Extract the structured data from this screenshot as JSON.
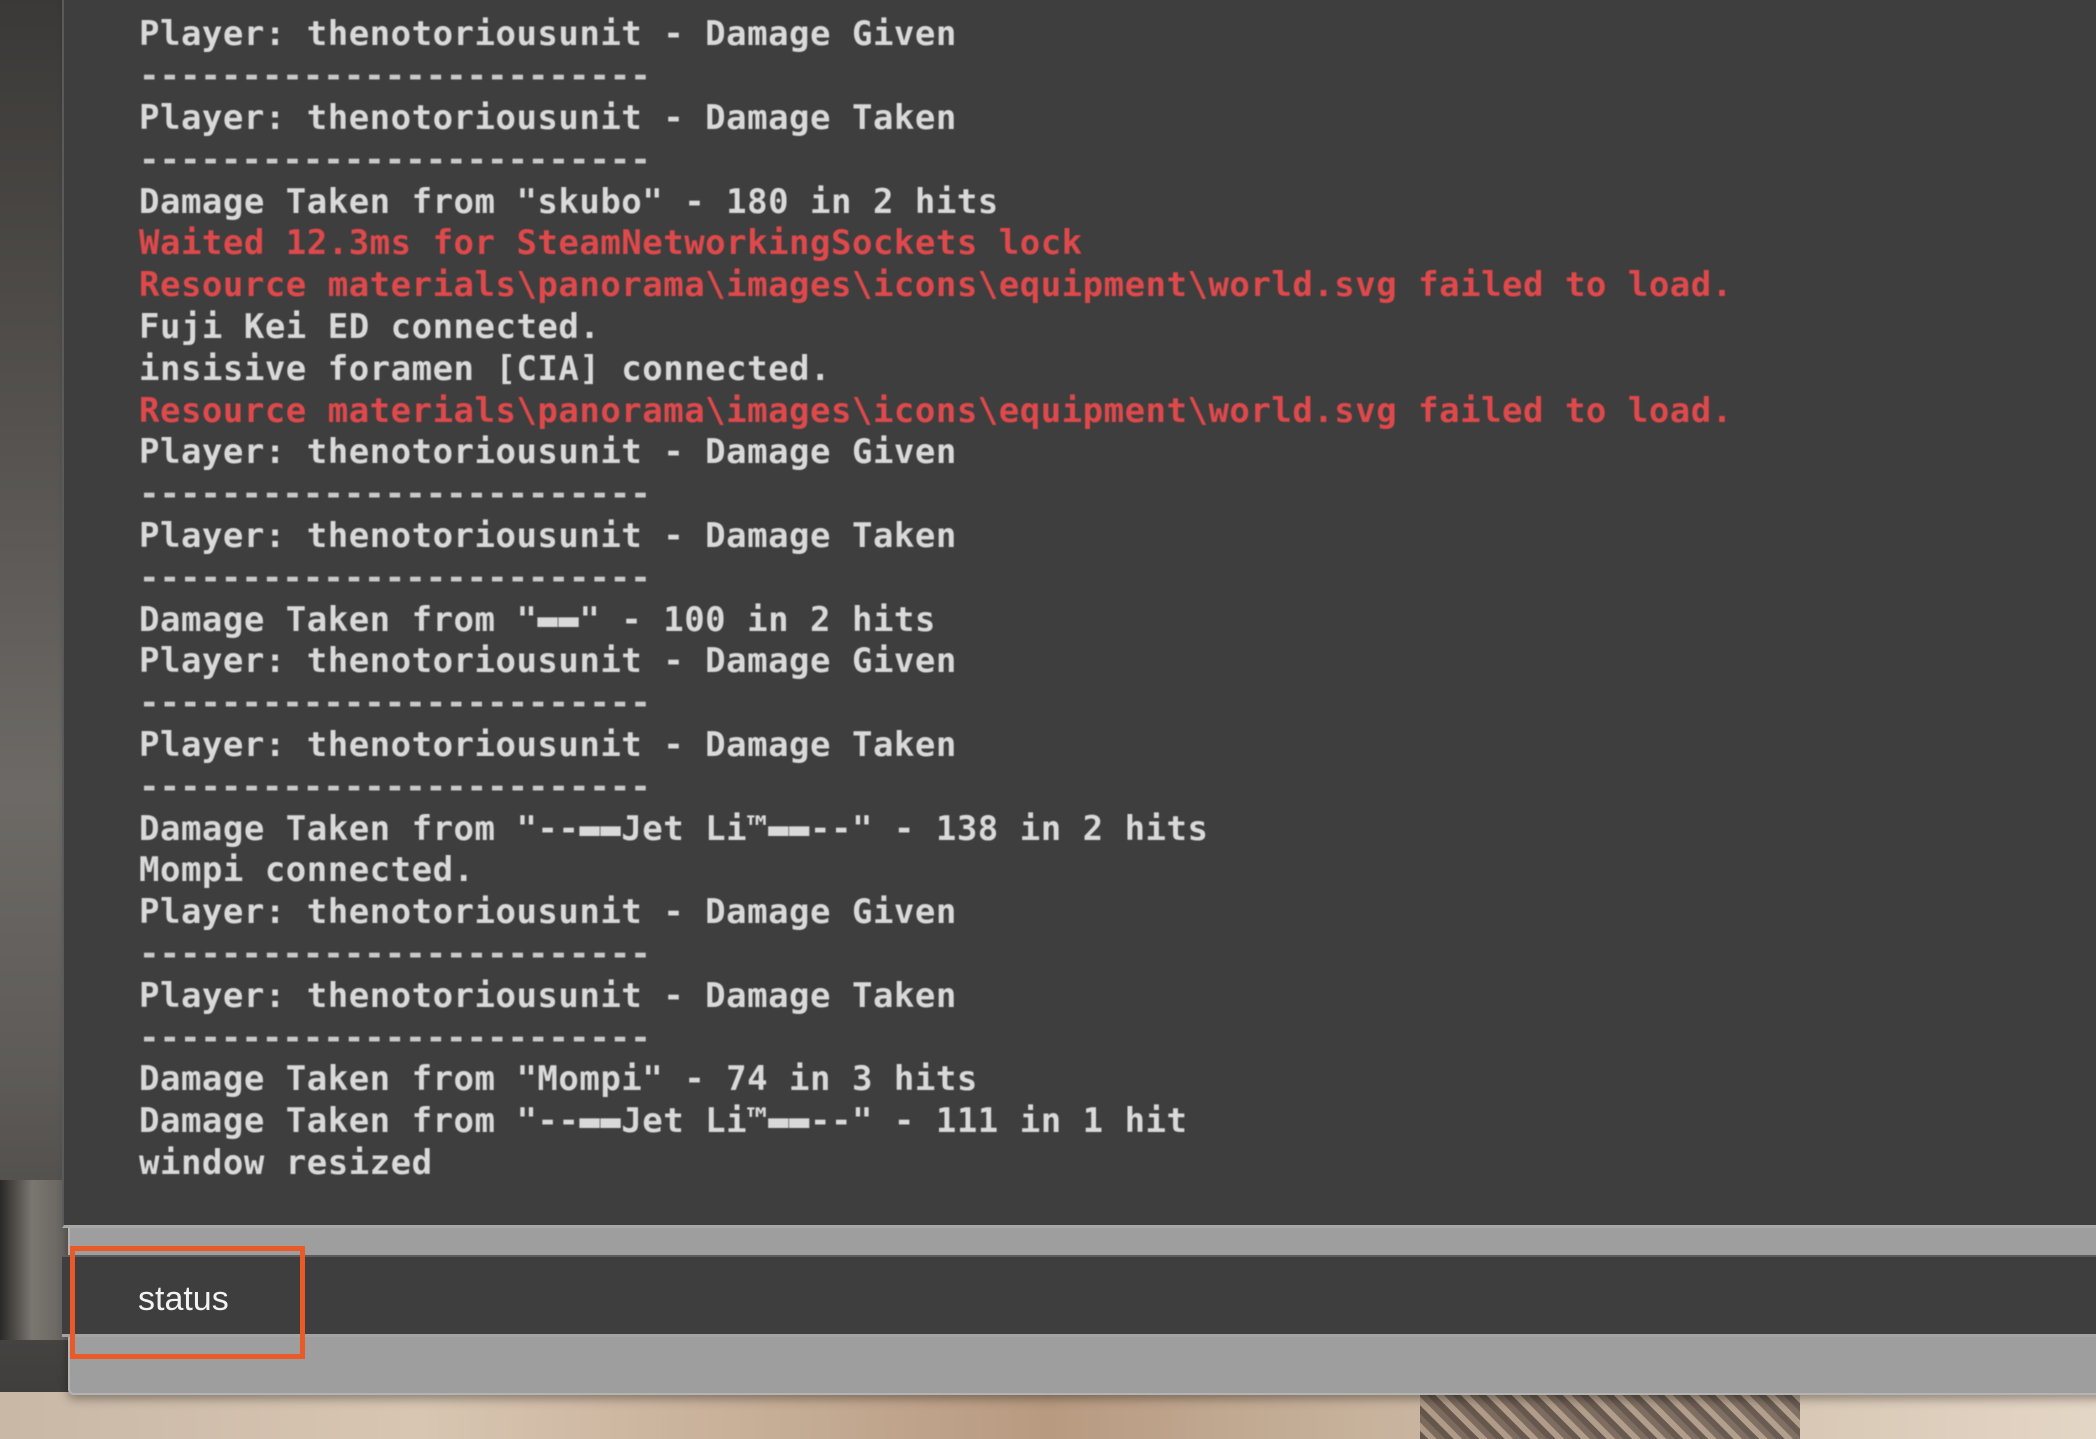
{
  "console": {
    "lines": [
      {
        "text": "Player: thenotoriousunit - Damage Given",
        "type": "normal"
      },
      {
        "text": "-------------------------",
        "type": "sep"
      },
      {
        "text": "Player: thenotoriousunit - Damage Taken",
        "type": "normal"
      },
      {
        "text": "-------------------------",
        "type": "sep"
      },
      {
        "text": "Damage Taken from \"skubo\" - 180 in 2 hits",
        "type": "normal"
      },
      {
        "text": "Waited 12.3ms for SteamNetworkingSockets lock",
        "type": "error"
      },
      {
        "text": "Resource materials\\panorama\\images\\icons\\equipment\\world.svg failed to load.",
        "type": "error"
      },
      {
        "text": "Fuji Kei ED connected.",
        "type": "normal"
      },
      {
        "text": "insisive foramen [CIA] connected.",
        "type": "normal"
      },
      {
        "text": "Resource materials\\panorama\\images\\icons\\equipment\\world.svg failed to load.",
        "type": "error"
      },
      {
        "text": "Player: thenotoriousunit - Damage Given",
        "type": "normal"
      },
      {
        "text": "-------------------------",
        "type": "sep"
      },
      {
        "text": "Player: thenotoriousunit - Damage Taken",
        "type": "normal"
      },
      {
        "text": "-------------------------",
        "type": "sep"
      },
      {
        "text": "Damage Taken from \"▬▬\" - 100 in 2 hits",
        "type": "normal"
      },
      {
        "text": "Player: thenotoriousunit - Damage Given",
        "type": "normal"
      },
      {
        "text": "-------------------------",
        "type": "sep"
      },
      {
        "text": "Player: thenotoriousunit - Damage Taken",
        "type": "normal"
      },
      {
        "text": "-------------------------",
        "type": "sep"
      },
      {
        "text": "Damage Taken from \"--▬▬Jet Li™▬▬--\" - 138 in 2 hits",
        "type": "normal"
      },
      {
        "text": "Mompi connected.",
        "type": "normal"
      },
      {
        "text": "Player: thenotoriousunit - Damage Given",
        "type": "normal"
      },
      {
        "text": "-------------------------",
        "type": "sep"
      },
      {
        "text": "Player: thenotoriousunit - Damage Taken",
        "type": "normal"
      },
      {
        "text": "-------------------------",
        "type": "sep"
      },
      {
        "text": "Damage Taken from \"Mompi\" - 74 in 3 hits",
        "type": "normal"
      },
      {
        "text": "Damage Taken from \"--▬▬Jet Li™▬▬--\" - 111 in 1 hit",
        "type": "normal"
      },
      {
        "text": "window resized",
        "type": "normal"
      }
    ],
    "input_value": "status",
    "colors": {
      "background": "#3e3e3e",
      "text": "#d9d9d9",
      "error": "#e0494b",
      "highlight": "#ea5a28"
    }
  }
}
